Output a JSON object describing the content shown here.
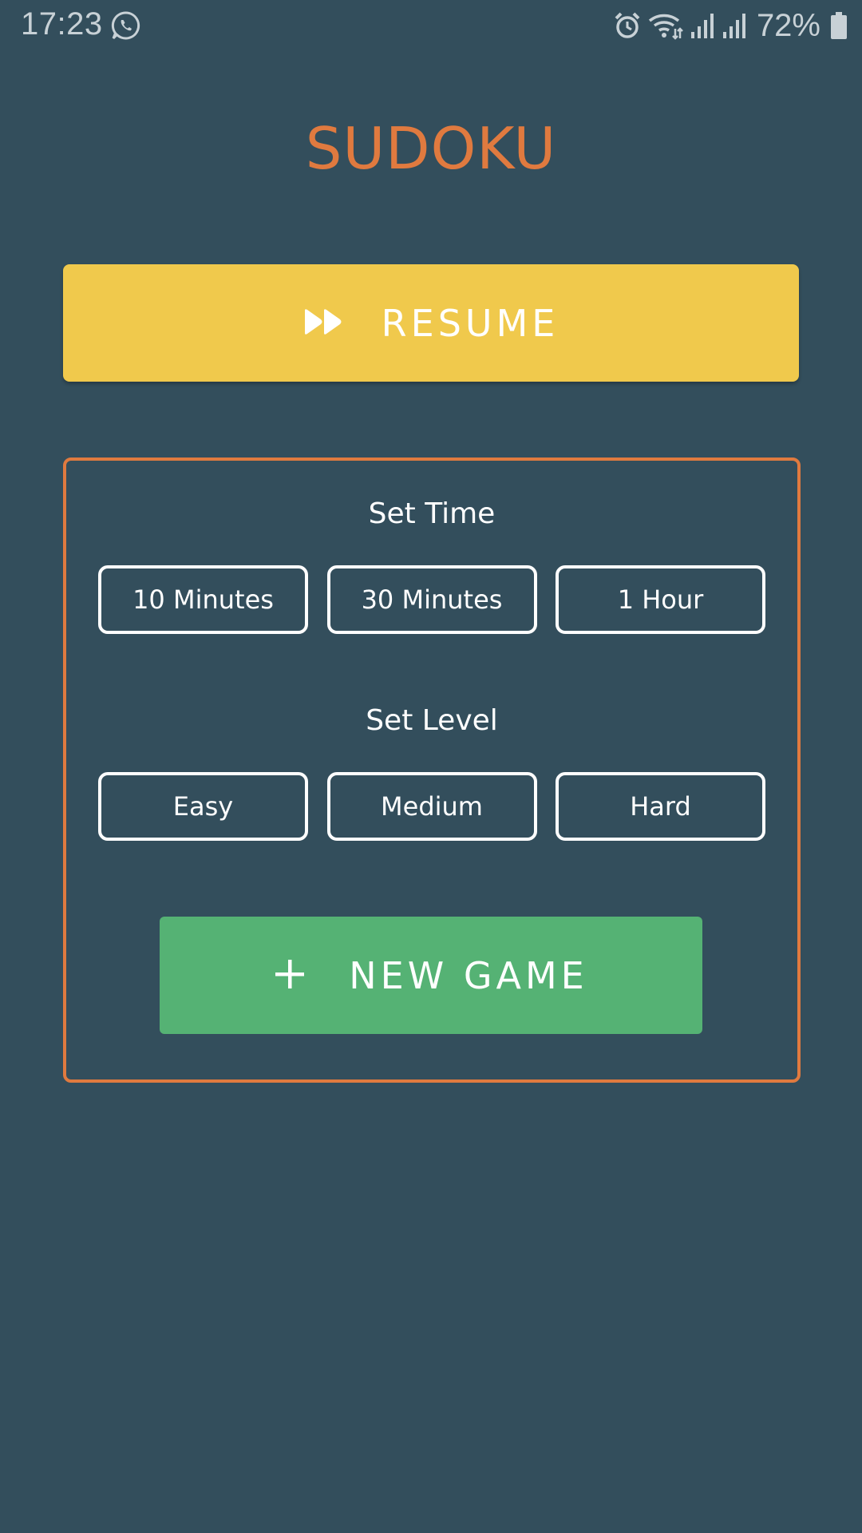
{
  "status_bar": {
    "time": "17:23",
    "battery_percent": "72%",
    "icons": [
      "whatsapp-icon",
      "alarm-icon",
      "wifi-icon",
      "signal-icon",
      "signal-icon",
      "battery-icon"
    ]
  },
  "app": {
    "title": "SUDOKU"
  },
  "resume": {
    "label": "RESUME",
    "icon": "fast-forward-icon",
    "color": "#f0c94c"
  },
  "settings": {
    "time_section": {
      "label": "Set Time",
      "options": [
        "10 Minutes",
        "30 Minutes",
        "1 Hour"
      ]
    },
    "level_section": {
      "label": "Set Level",
      "options": [
        "Easy",
        "Medium",
        "Hard"
      ]
    },
    "border_color": "#e07a3f"
  },
  "new_game": {
    "label": "NEW GAME",
    "icon": "plus-icon",
    "color": "#55b274"
  },
  "colors": {
    "background": "#334e5c",
    "accent": "#e07a3f"
  }
}
